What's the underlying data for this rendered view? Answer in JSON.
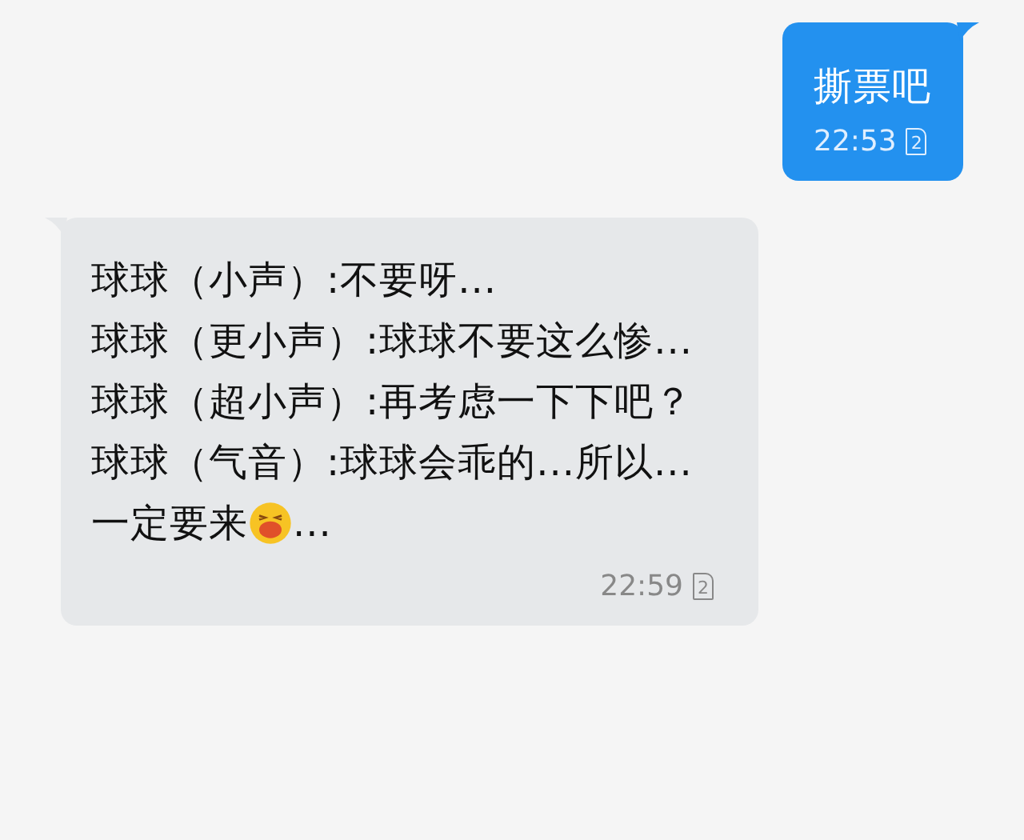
{
  "messages": [
    {
      "kind": "outgoing",
      "segments_lines": [
        [
          {
            "kind": "text",
            "text": "撕票吧"
          }
        ]
      ],
      "time": "22:53",
      "sim": "2"
    },
    {
      "kind": "incoming",
      "segments_lines": [
        [
          {
            "kind": "text",
            "text": "球球（小声）:不要呀..."
          }
        ],
        [
          {
            "kind": "text",
            "text": "球球（更小声）:球球不要这么惨..."
          }
        ],
        [
          {
            "kind": "text",
            "text": "球球（超小声）:再考虑一下下吧？"
          }
        ],
        [
          {
            "kind": "text",
            "text": "球球（气音）:球球会乖的...所以...一定要来"
          },
          {
            "kind": "emoji"
          },
          {
            "kind": "text",
            "text": "..."
          }
        ]
      ],
      "time": "22:59",
      "sim": "2"
    }
  ]
}
